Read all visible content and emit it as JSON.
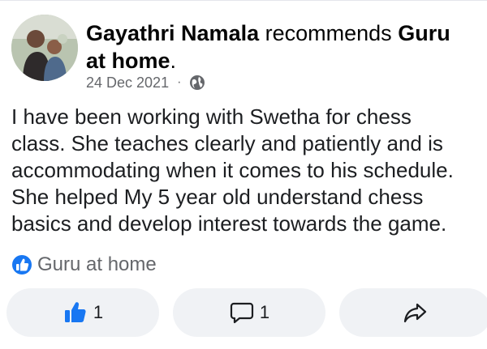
{
  "post": {
    "author": "Gayathri Namala",
    "action_text": "recommends",
    "page_name": "Guru at home",
    "page_name_line1": "Guru",
    "page_name_line2": "at home",
    "terminal": ".",
    "date": "24 Dec 2021",
    "meta_separator": "·",
    "privacy_icon": "globe-icon",
    "body": "I have been working with Swetha for chess\nclass. She teaches clearly and patiently and is\naccommodating when it comes to his schedule.\nShe helped My 5 year old understand chess\nbasics and develop interest towards the game.",
    "recommend_icon": "recommend-thumb-icon",
    "recommend_label": "Guru at home"
  },
  "actions": {
    "like_count": "1",
    "comment_count": "1",
    "like_icon": "thumbs-up-icon",
    "comment_icon": "comment-bubble-icon",
    "share_icon": "share-arrow-icon"
  },
  "colors": {
    "accent_blue": "#1877f2",
    "text_primary": "#050505",
    "text_secondary": "#65676b",
    "button_bg": "#f0f2f5"
  }
}
